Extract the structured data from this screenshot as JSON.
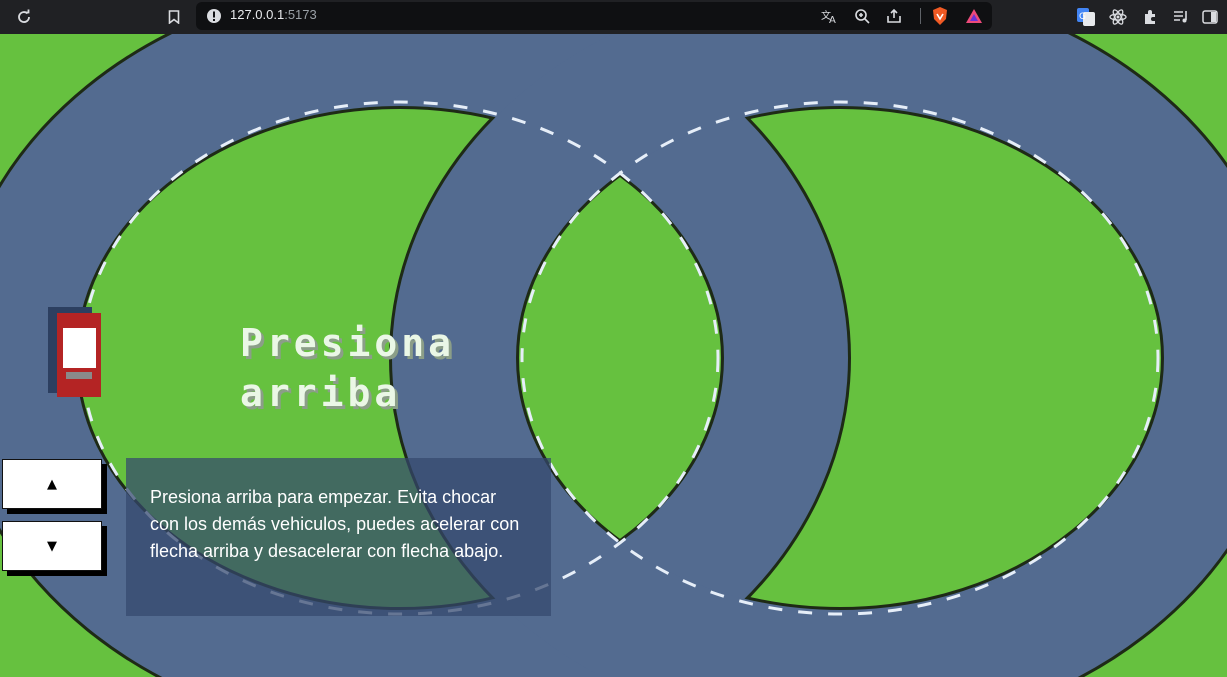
{
  "browser": {
    "url_host": "127.0.0.1",
    "url_port": ":5173",
    "reload_icon": "reload-icon",
    "bookmark_icon": "bookmark-icon",
    "info_icon": "info-icon",
    "toolbar_icons": [
      "translate-icon",
      "zoom-icon",
      "share-icon",
      "brave-shield-icon",
      "brave-rewards-icon",
      "google-translate-icon",
      "react-devtools-icon",
      "extensions-icon",
      "media-icon",
      "sidebar-icon"
    ]
  },
  "game": {
    "title_line1": "Presiona",
    "title_line2": "arriba",
    "up_button": "▲",
    "down_button": "▼",
    "instructions": "Presiona arriba para empezar. Evita chocar con los demás vehiculos, puedes acelerar con flecha arriba y desacelerar con flecha abajo.",
    "colors": {
      "grass": "#66c13f",
      "track": "#536b90",
      "track_edge": "#1e2a16",
      "lane_marks": "#e6eef8",
      "car_body": "#b42424"
    }
  }
}
